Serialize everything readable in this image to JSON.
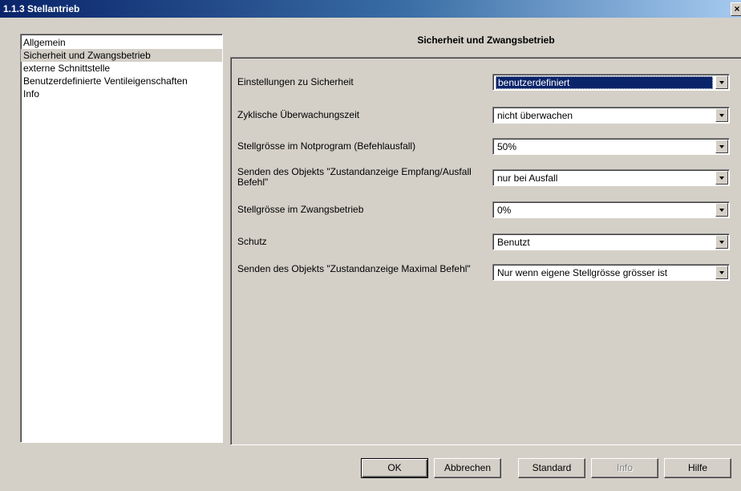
{
  "window": {
    "title": "1.1.3 Stellantrieb",
    "close_glyph": "×"
  },
  "sidebar": {
    "items": [
      {
        "label": "Allgemein",
        "selected": false
      },
      {
        "label": "Sicherheit und Zwangsbetrieb",
        "selected": true
      },
      {
        "label": "externe Schnittstelle",
        "selected": false
      },
      {
        "label": "Benutzerdefinierte Ventileigenschaften",
        "selected": false
      },
      {
        "label": "Info",
        "selected": false
      }
    ]
  },
  "main": {
    "title": "Sicherheit und Zwangsbetrieb",
    "params": [
      {
        "label": "Einstellungen zu Sicherheit",
        "value": "benutzerdefiniert",
        "focused": true
      },
      {
        "label": "Zyklische Überwachungszeit",
        "value": "nicht überwachen"
      },
      {
        "label": "Stellgrösse im Notprogram (Befehlausfall)",
        "value": "50%"
      },
      {
        "label": "Senden des Objekts \"Zustandanzeige Empfang/Ausfall Befehl\"",
        "value": "nur bei Ausfall"
      },
      {
        "label": "Stellgrösse im Zwangsbetrieb",
        "value": "0%"
      },
      {
        "label": "Schutz",
        "value": "Benutzt"
      },
      {
        "label": "Senden des Objekts \"Zustandanzeige Maximal Befehl\"",
        "value": "Nur wenn eigene Stellgrösse grösser ist"
      }
    ]
  },
  "buttons": {
    "ok": "OK",
    "cancel": "Abbrechen",
    "standard": "Standard",
    "info": "Info",
    "help": "Hilfe"
  }
}
